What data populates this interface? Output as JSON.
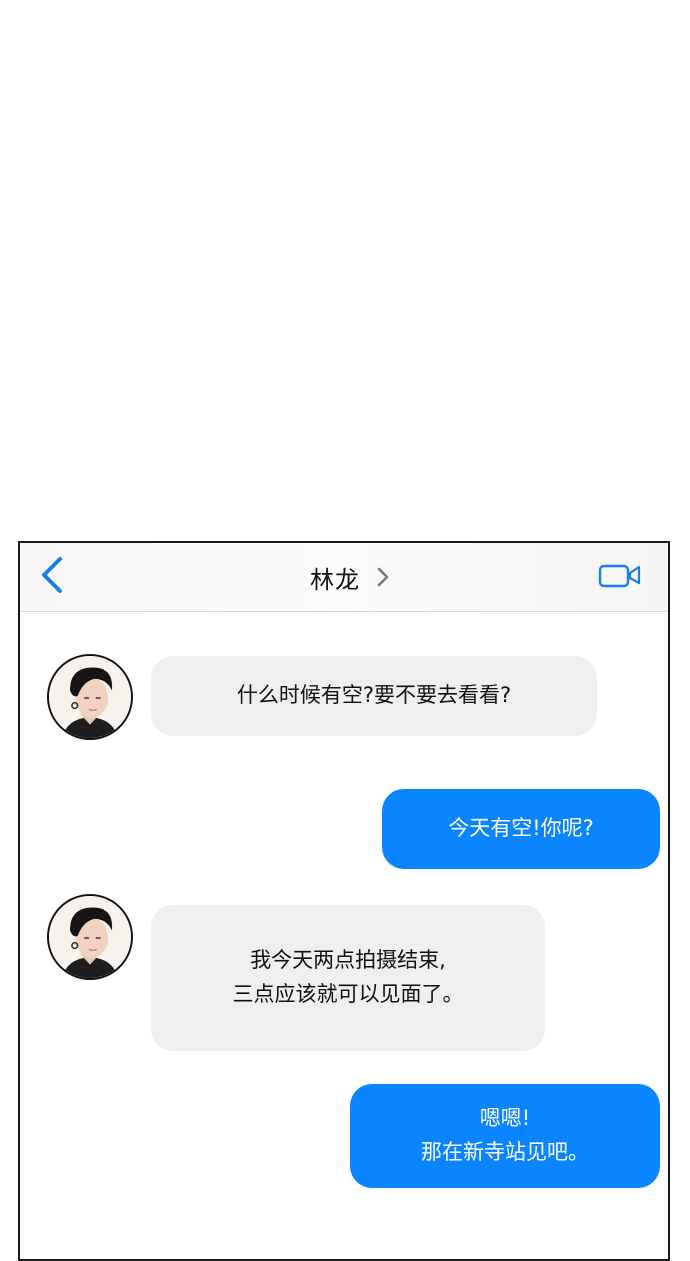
{
  "header": {
    "back_icon": "chevron-left-icon",
    "contact_name": "林龙",
    "detail_icon": "chevron-right-icon",
    "video_icon": "video-camera-icon",
    "accent_color": "#0a84ff"
  },
  "messages": [
    {
      "side": "incoming",
      "lines": [
        "什么时候有空?要不要去看看?"
      ]
    },
    {
      "side": "outgoing",
      "lines": [
        "今天有空!你呢?"
      ]
    },
    {
      "side": "incoming",
      "lines": [
        "我今天两点拍摄结束,",
        "三点应该就可以见面了。"
      ]
    },
    {
      "side": "outgoing",
      "lines": [
        "嗯嗯!",
        "那在新寺站见吧。"
      ]
    }
  ],
  "colors": {
    "incoming_bubble": "#efefef",
    "outgoing_bubble": "#0a84ff",
    "outgoing_text": "#ffffff"
  }
}
